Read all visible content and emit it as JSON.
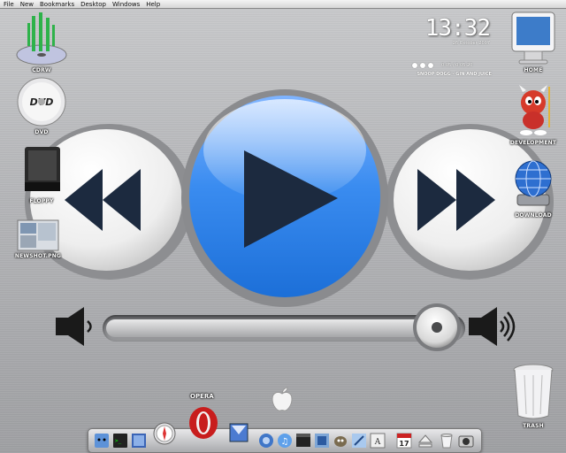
{
  "menubar": {
    "items": [
      "File",
      "New",
      "Bookmarks",
      "Desktop",
      "Windows",
      "Help"
    ]
  },
  "desktop_icons": {
    "cdrw": "CDRW",
    "dvd": "DVD",
    "floppy": "FLOPPY",
    "newshot": "NEWSHOT.PNG",
    "home": "HOME",
    "development": "DEVELOPMENT",
    "download": "DOWNLOAD",
    "trash": "TRASH"
  },
  "clock": {
    "time": "13:32",
    "date": "26 October 2007"
  },
  "player": {
    "track_time": "0:05 / 0:05:20",
    "track_name": "SNOOP DOGG - GIN AND JUICE"
  },
  "dock": {
    "opera_label": "OPERA",
    "calendar_day": "17"
  },
  "controls": {
    "volume_level": 0.93
  },
  "colors": {
    "play_blue": "#2f7fe0",
    "dark_navy": "#1c2a3f",
    "metal": "#b4b5b8"
  }
}
